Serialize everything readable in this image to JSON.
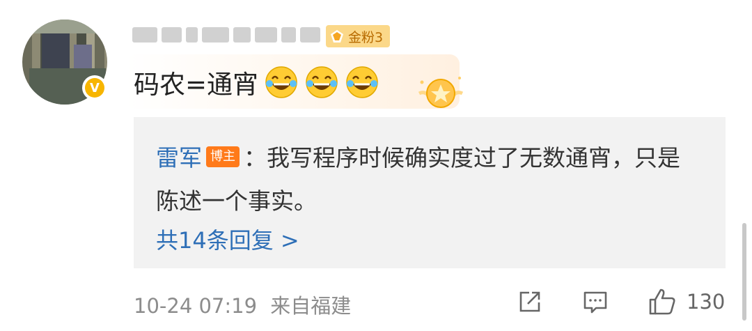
{
  "comment": {
    "fan_badge": "金粉3",
    "text": "码农=通宵",
    "emoji_count": 3
  },
  "reply": {
    "author": "雷军",
    "author_badge": "博主",
    "separator": "：",
    "text": "我写程序时候确实度过了无数通宵，只是陈述一个事实。",
    "more_label": "共14条回复 >"
  },
  "footer": {
    "time": "10-24 07:19",
    "source": "来自福建",
    "like_count": "130"
  },
  "icons": [
    "share-icon",
    "comment-icon",
    "like-icon",
    "verified-icon",
    "laugh-emoji-icon",
    "fan-gem-icon",
    "trophy-icon"
  ],
  "colors": {
    "link": "#2e6fb7",
    "fan_badge_bg": "#fbd889",
    "blogger_badge_bg": "#ff7a1a",
    "reply_bg": "#f2f2f2"
  }
}
